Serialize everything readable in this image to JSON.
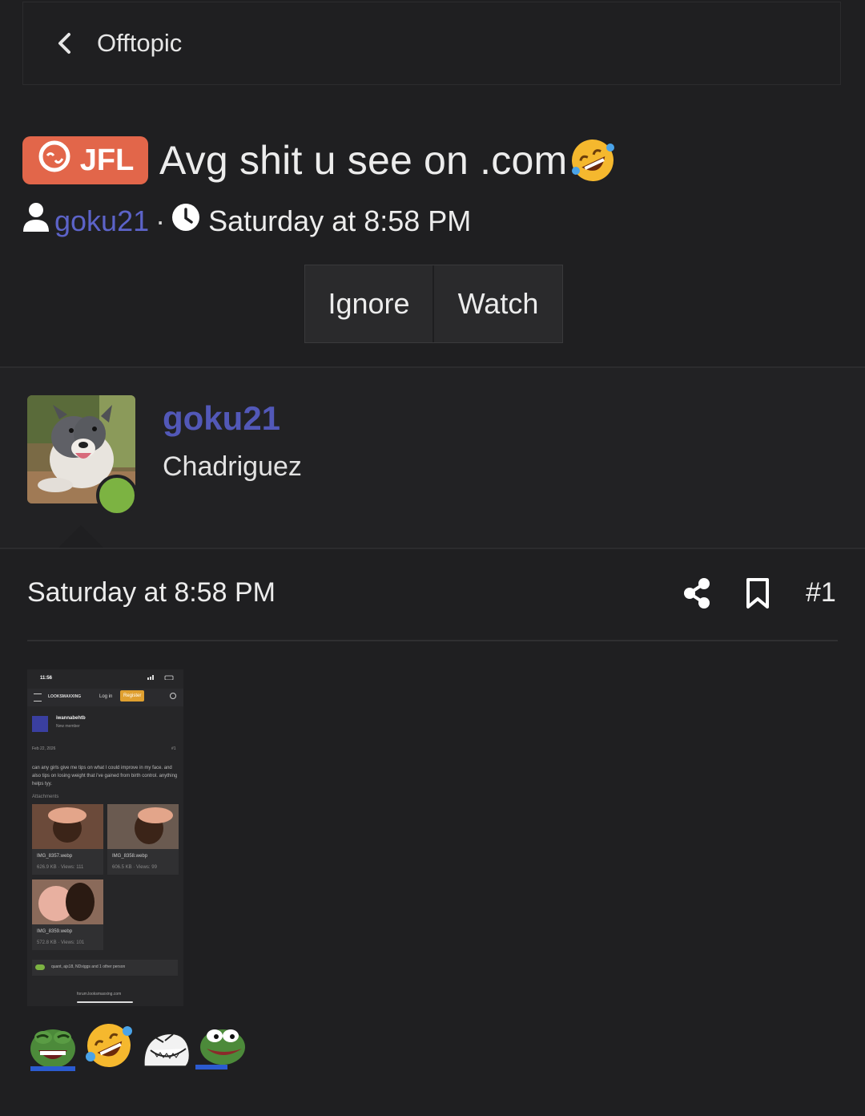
{
  "breadcrumb": {
    "label": "Offtopic"
  },
  "thread": {
    "prefix": "JFL",
    "title": "Avg shit u see on .com",
    "author": "goku21",
    "separator": "·",
    "time": "Saturday at 8:58 PM"
  },
  "actions": {
    "ignore": "Ignore",
    "watch": "Watch"
  },
  "user": {
    "name": "goku21",
    "title": "Chadriguez"
  },
  "post": {
    "date": "Saturday at 8:58 PM",
    "number": "#1"
  },
  "attachment": {
    "status_time": "11:56",
    "site": "LOOKSMAXXING",
    "login": "Log in",
    "register": "Register",
    "op_name": "iwannabehtb",
    "op_role": "New member",
    "date": "Feb 22, 2026",
    "num": "#1",
    "body": "can any girls give me tips on what I could improve in my face. and also tips on losing weight that i've gained from birth control. anything helps tyy.",
    "attachments_label": "Attachments",
    "files": [
      {
        "name": "IMG_8357.webp",
        "info": "626.9 KB · Views: 111"
      },
      {
        "name": "IMG_8358.webp",
        "info": "606.5 KB · Views: 99"
      },
      {
        "name": "IMG_8359.webp",
        "info": "572.8 KB · Views: 101"
      }
    ],
    "reactions": "quant, ajs18, NDxiggs and 1 other person",
    "url": "forum.looksmaxxing.com"
  },
  "icons": [
    "chevron-left-icon",
    "laugh-prefix-icon",
    "rofl-emoji-icon",
    "user-icon",
    "clock-icon",
    "share-icon",
    "bookmark-icon"
  ],
  "colors": {
    "prefix": "#e2664a",
    "username": "#5258b8",
    "online": "#7cb342"
  }
}
